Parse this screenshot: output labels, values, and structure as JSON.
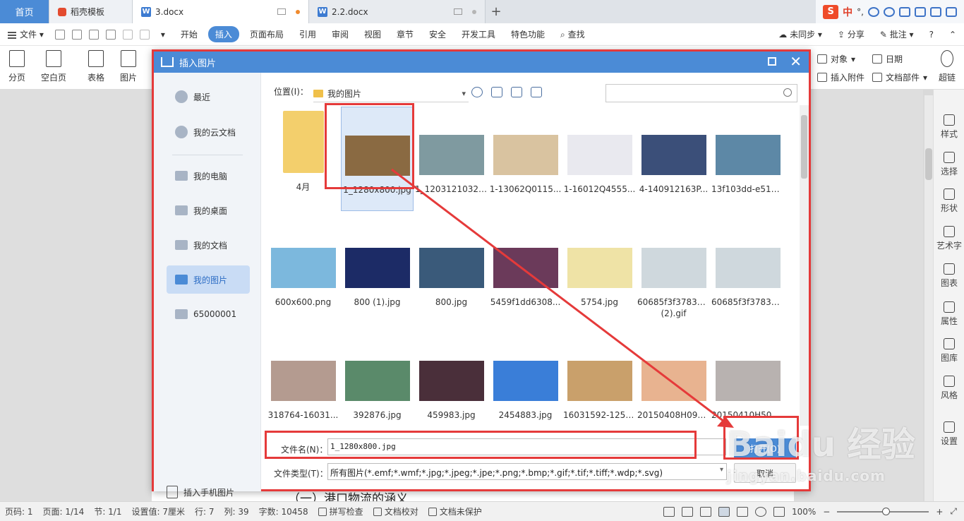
{
  "tabs": {
    "home": "首页",
    "template": "稻壳模板",
    "doc1": "3.docx",
    "doc2": "2.2.docx",
    "new": "+"
  },
  "ime": {
    "logo": "S",
    "lang": "中",
    "punct": "°,"
  },
  "menu": {
    "file": "文件",
    "items": [
      "开始",
      "插入",
      "页面布局",
      "引用",
      "审阅",
      "视图",
      "章节",
      "安全",
      "开发工具",
      "特色功能"
    ],
    "active_index": 1,
    "search": "查找",
    "sync": "未同步",
    "share": "分享",
    "comment": "批注",
    "help": "?"
  },
  "ribbon": {
    "pagebreak": "分页",
    "blankpage": "空白页",
    "table": "表格",
    "picture": "图片",
    "object": "对象",
    "date": "日期",
    "attach": "插入附件",
    "docpart": "文档部件",
    "hyperlink": "超链"
  },
  "dialog": {
    "title": "插入图片",
    "sidebar": [
      "最近",
      "我的云文档",
      "我的电脑",
      "我的桌面",
      "我的文档",
      "我的图片",
      "65000001"
    ],
    "active_index": 5,
    "phone": "插入手机图片",
    "location_label": "位置(I)：",
    "location_value": "我的图片",
    "search_placeholder": "",
    "filename_label": "文件名(N)：",
    "filename_value": "1_1280x800.jpg",
    "filetype_label": "文件类型(T)：",
    "filetype_value": "所有图片(*.emf;*.wmf;*.jpg;*.jpeg;*.jpe;*.png;*.bmp;*.gif;*.tif;*.tiff;*.wdp;*.svg)",
    "open": "打开(O)",
    "cancel": "取消"
  },
  "files": [
    {
      "name": "4月",
      "kind": "folder",
      "color": "#f3cf6c"
    },
    {
      "name": "1_1280x800.jpg",
      "kind": "image",
      "color": "#8a6a42",
      "selected": true
    },
    {
      "name": "1_12031210323...",
      "kind": "image",
      "color": "#7f9aa0"
    },
    {
      "name": "1-13062Q0115...",
      "kind": "image",
      "color": "#d9c3a0"
    },
    {
      "name": "1-16012Q4555...",
      "kind": "image",
      "color": "#e9e9ef"
    },
    {
      "name": "4-140912163P...",
      "kind": "image",
      "color": "#3b4f79"
    },
    {
      "name": "13f103dd-e51e...",
      "kind": "image",
      "color": "#5d88a6"
    },
    {
      "name": "600x600.png",
      "kind": "image",
      "color": "#7cb8dd"
    },
    {
      "name": "800 (1).jpg",
      "kind": "image",
      "color": "#1c2b66"
    },
    {
      "name": "800.jpg",
      "kind": "image",
      "color": "#3a5a7a"
    },
    {
      "name": "5459f1dd6308...",
      "kind": "image",
      "color": "#6b3a5a"
    },
    {
      "name": "5754.jpg",
      "kind": "image",
      "color": "#efe3a6"
    },
    {
      "name": "60685f3f3783e...(2).gif",
      "kind": "image",
      "color": "#cfd8dd"
    },
    {
      "name": "60685f3f3783e...",
      "kind": "image",
      "color": "#cfd8dd"
    },
    {
      "name": "318764-16031...",
      "kind": "image",
      "color": "#b49b90"
    },
    {
      "name": "392876.jpg",
      "kind": "image",
      "color": "#5a8a6a"
    },
    {
      "name": "459983.jpg",
      "kind": "image",
      "color": "#4a2f3a"
    },
    {
      "name": "2454883.jpg",
      "kind": "image",
      "color": "#3a7ed8"
    },
    {
      "name": "16031592-125c...",
      "kind": "image",
      "color": "#c9a06b"
    },
    {
      "name": "20150408H090...",
      "kind": "image",
      "color": "#e8b390"
    },
    {
      "name": "20150410H500...",
      "kind": "image",
      "color": "#b8b2b0"
    }
  ],
  "rail": [
    "样式",
    "选择",
    "形状",
    "艺术字",
    "图表",
    "属性",
    "图库",
    "风格",
    "设置"
  ],
  "doc_text": "（一）港口物流的涵义",
  "status": {
    "page_no": "页码: 1",
    "pages": "页面: 1/14",
    "section": "节: 1/1",
    "setting": "设置值: 7厘米",
    "row": "行: 7",
    "col": "列: 39",
    "words": "字数: 10458",
    "spell": "拼写检查",
    "proof": "文档校对",
    "protect": "文档未保护",
    "zoom": "100%"
  },
  "watermark": {
    "main": "Baidu 经验",
    "sub": "jingyan.baidu.com"
  },
  "colors": {
    "accent": "#4b8bd6",
    "highlight": "#e53a3a"
  }
}
